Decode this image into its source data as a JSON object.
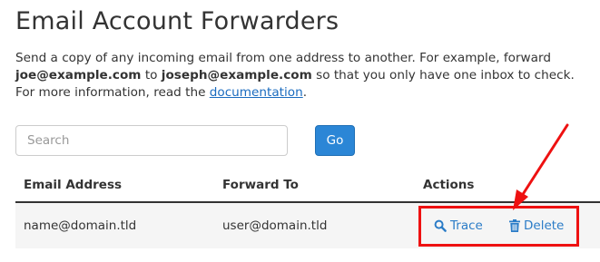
{
  "page": {
    "title": "Email Account Forwarders"
  },
  "intro": {
    "text_1": "Send a copy of any incoming email from one address to another. For example, forward",
    "example_from": "joe@example.com",
    "text_to": "to",
    "example_to": "joseph@example.com",
    "text_2": "so that you only have one inbox to check. For more information, read the",
    "link_label": "documentation",
    "text_end": "."
  },
  "search": {
    "placeholder": "Search",
    "go_label": "Go"
  },
  "table": {
    "columns": [
      "Email Address",
      "Forward To",
      "Actions"
    ],
    "rows": [
      {
        "email": "name@domain.tld",
        "forward_to": "user@domain.tld",
        "actions": [
          {
            "label": "Trace",
            "icon": "search-icon"
          },
          {
            "label": "Delete",
            "icon": "trash-icon"
          }
        ]
      }
    ]
  },
  "colors": {
    "accent": "#2b86d6",
    "link": "#1a6bbf",
    "annotation": "#ee1111"
  }
}
